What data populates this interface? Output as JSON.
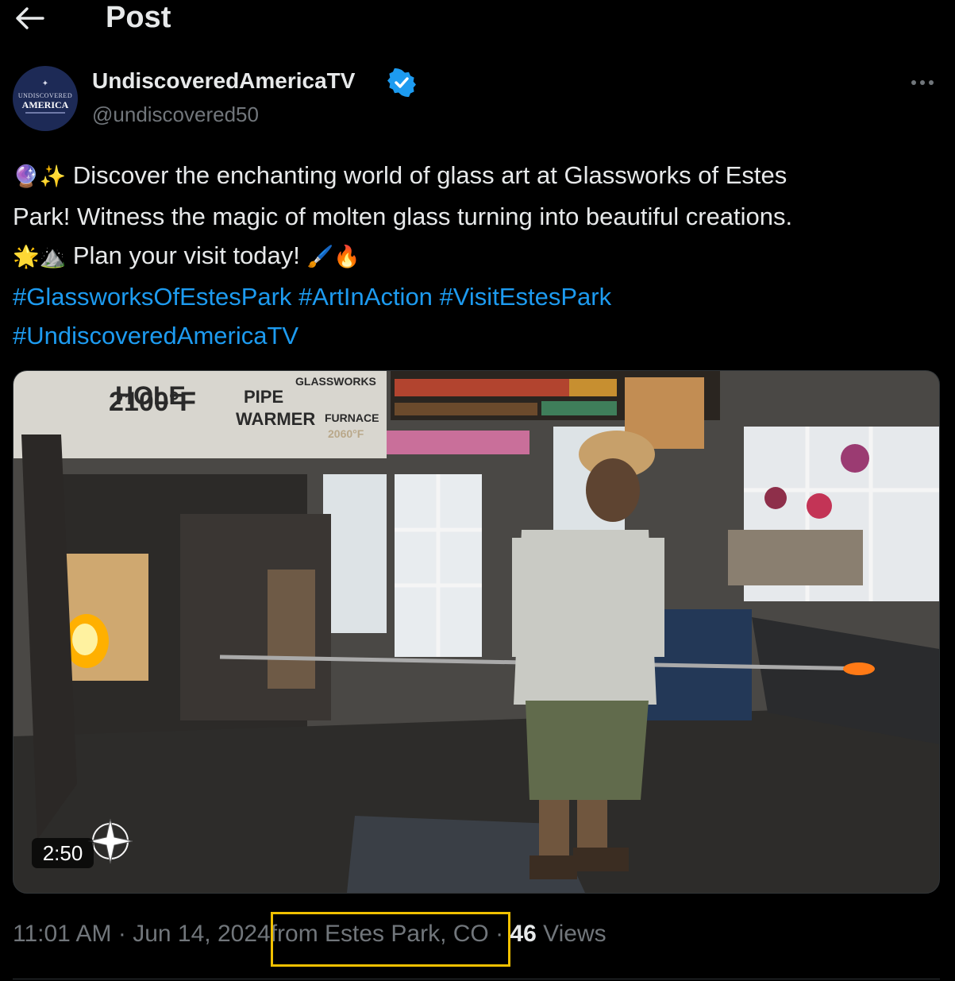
{
  "header": {
    "title": "Post",
    "back_icon": "arrow-left-icon"
  },
  "author": {
    "display_name": "UndiscoveredAmericaTV",
    "handle": "@undiscovered50",
    "avatar_text_top": "UNDISCOVERED",
    "avatar_text_main": "AMERICA",
    "verified_color": "#1d9bf0"
  },
  "post": {
    "text_line1": " Discover the enchanting world of glass art at Glassworks of Estes",
    "text_line2": "Park! Witness the magic of molten glass turning into beautiful creations.",
    "text_line3": " Plan your visit today! ",
    "emoji": {
      "crystal_ball": "🔮",
      "sparkles": "✨",
      "sun": "🌟",
      "mountain": "⛰️",
      "brush": "🖌️",
      "fire": "🔥"
    },
    "hashtags": [
      "#GlassworksOfEstesPark",
      "#ArtInAction",
      "#VisitEstesPark",
      "#UndiscoveredAmericaTV"
    ]
  },
  "media": {
    "duration": "2:50",
    "sign_hole": "HOLE",
    "sign_temp": "2100°F",
    "sign_pipe": "PIPE",
    "sign_warmer": "WARMER",
    "sign_glassworks": "GLASSWORKS",
    "sign_furnace": "FURNACE",
    "sign_furnace_temp": "2060°F"
  },
  "meta": {
    "time": "11:01 AM",
    "date": "Jun 14, 2024",
    "source": "from Estes Park, CO",
    "views_count": "46",
    "views_label": "Views",
    "sep": " · "
  },
  "colors": {
    "accent": "#1d9bf0",
    "muted": "#71767b",
    "highlight": "#f0c000"
  }
}
